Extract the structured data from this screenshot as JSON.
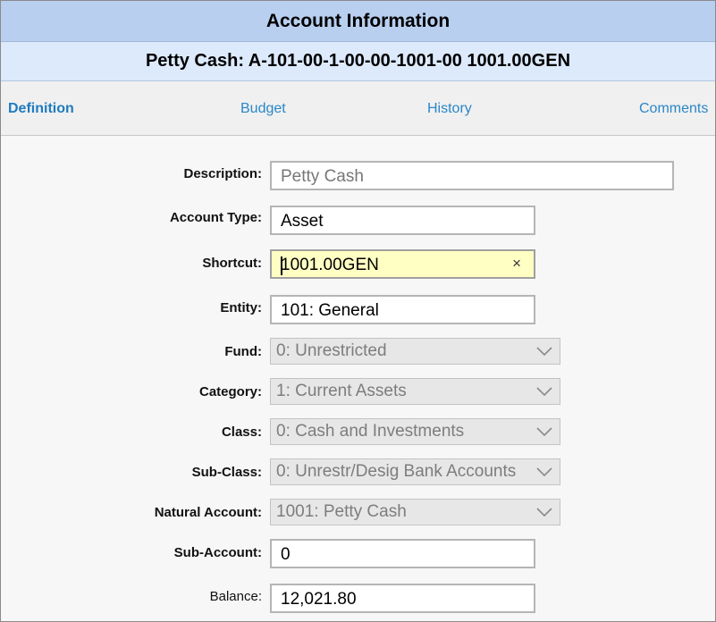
{
  "window": {
    "title": "Account Information",
    "subtitle": "Petty Cash: A-101-00-1-00-00-1001-00 1001.00GEN"
  },
  "tabs": [
    {
      "label": "Definition",
      "active": true
    },
    {
      "label": "Budget",
      "active": false
    },
    {
      "label": "History",
      "active": false
    },
    {
      "label": "Comments",
      "active": false
    }
  ],
  "form": {
    "description": {
      "label": "Description:",
      "value": "Petty Cash"
    },
    "account_type": {
      "label": "Account Type:",
      "value": "Asset"
    },
    "shortcut": {
      "label": "Shortcut:",
      "value": "1001.00GEN",
      "clear_glyph": "×"
    },
    "entity": {
      "label": "Entity:",
      "value": "101: General"
    },
    "fund": {
      "label": "Fund:",
      "value": "0: Unrestricted"
    },
    "category": {
      "label": "Category:",
      "value": "1: Current Assets"
    },
    "class": {
      "label": "Class:",
      "value": "0: Cash and Investments"
    },
    "sub_class": {
      "label": "Sub-Class:",
      "value": "0: Unrestr/Desig Bank Accounts"
    },
    "natural_account": {
      "label": "Natural Account:",
      "value": "1001: Petty Cash"
    },
    "sub_account": {
      "label": "Sub-Account:",
      "value": "0"
    },
    "balance": {
      "label": "Balance:",
      "value": "12,021.80"
    }
  },
  "icons": {
    "dropdown": "chevron-down-icon",
    "clear": "close-icon"
  },
  "colors": {
    "title_bg": "#b8cff0",
    "subtitle_bg": "#ddeafc",
    "tab_link": "#2a87c7",
    "focus_bg": "#ffffc4",
    "disabled_bg": "#e7e7e7"
  }
}
